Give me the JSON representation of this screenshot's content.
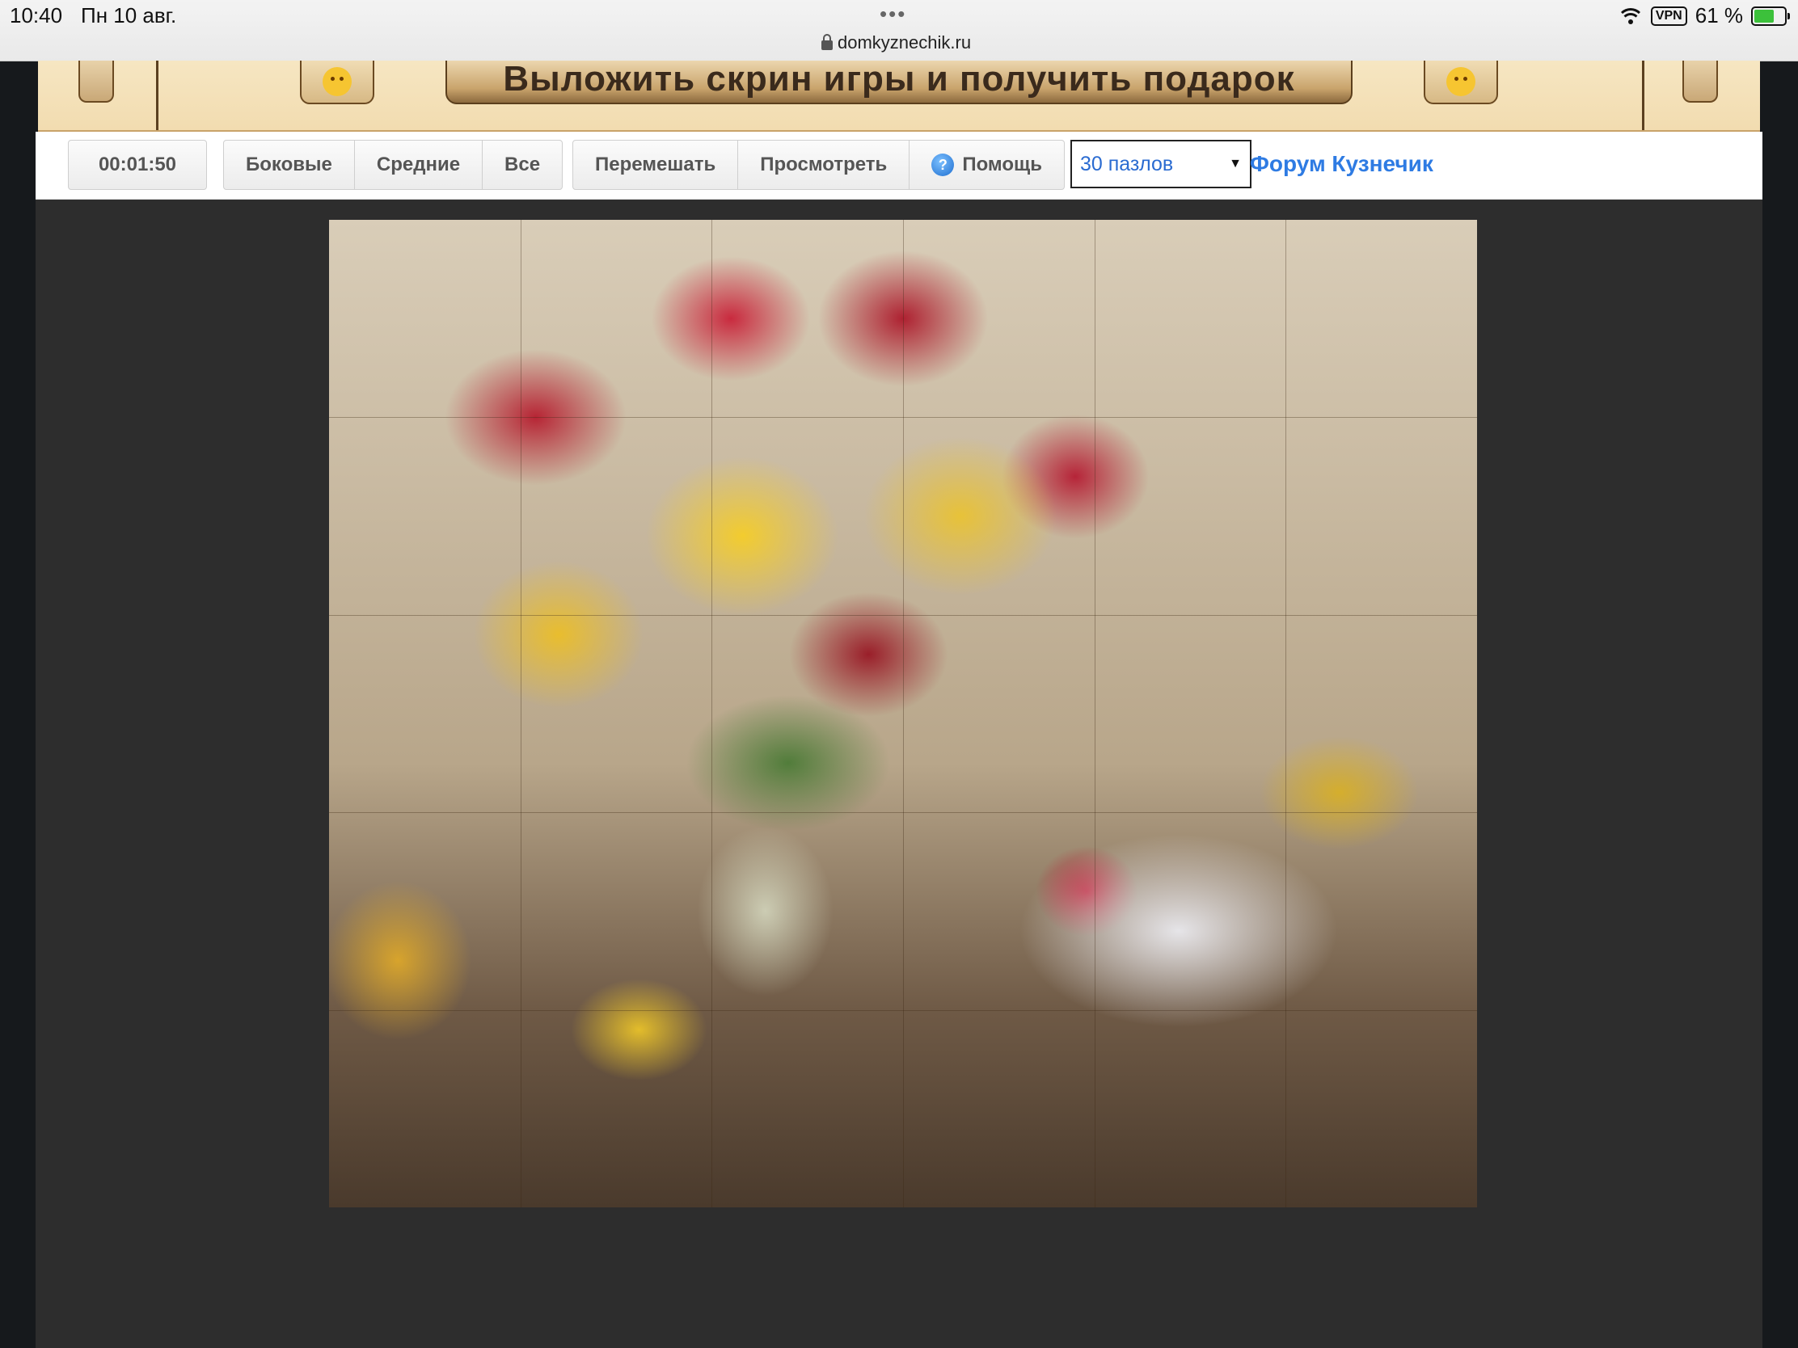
{
  "statusbar": {
    "time": "10:40",
    "date": "Пн 10 авг.",
    "url": "domkyznechik.ru",
    "vpn": "VPN",
    "battery": "61 %"
  },
  "banner": {
    "text": "Выложить скрин игры и получить подарок"
  },
  "toolbar": {
    "timer": "00:01:50",
    "filter_buttons": [
      "Боковые",
      "Средние",
      "Все"
    ],
    "action_buttons": {
      "shuffle": "Перемешать",
      "preview": "Просмотреть",
      "help": "Помощь"
    },
    "help_glyph": "?",
    "piece_count": "30 пазлов",
    "forum_link": "Форум Кузнечик"
  },
  "puzzle": {
    "image_name": "flowers-in-vase-puzzle",
    "pieces": 30,
    "columns": 6,
    "rows": 5
  },
  "colors": {
    "link": "#2e7be3",
    "banner_bg": "#f2dcb0",
    "game_bg": "#2d2d2d",
    "page_bg": "#16191c"
  }
}
